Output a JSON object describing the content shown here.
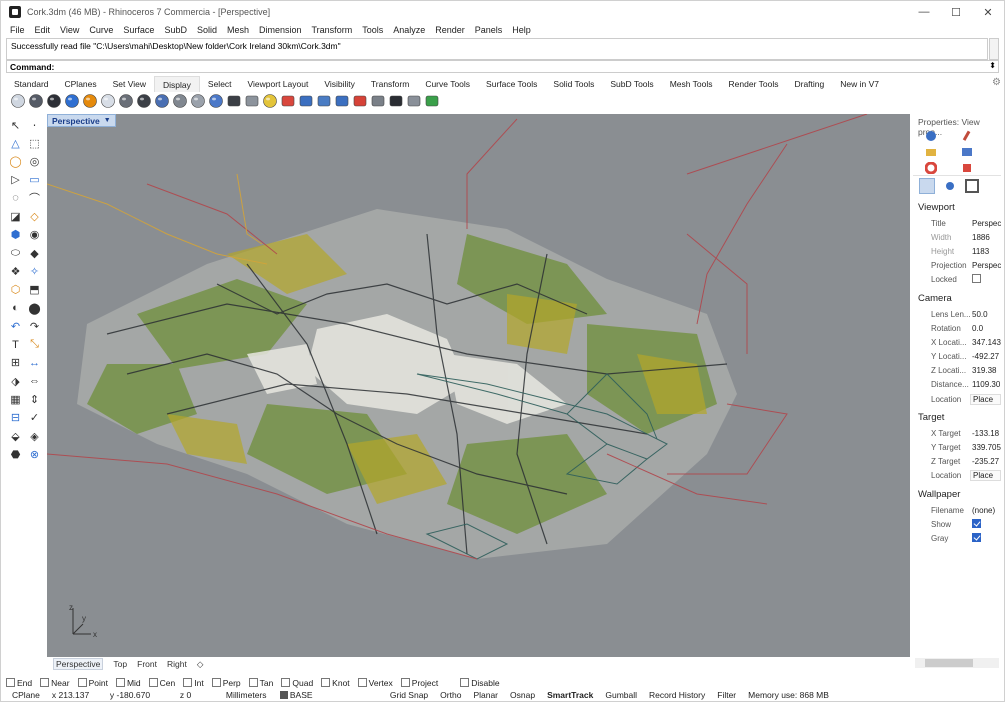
{
  "window": {
    "title": "Cork.3dm (46 MB) - Rhinoceros 7 Commercia - [Perspective]",
    "minimize": "—",
    "maximize": "☐",
    "close": "✕"
  },
  "menu": [
    "File",
    "Edit",
    "View",
    "Curve",
    "Surface",
    "SubD",
    "Solid",
    "Mesh",
    "Dimension",
    "Transform",
    "Tools",
    "Analyze",
    "Render",
    "Panels",
    "Help"
  ],
  "command": {
    "history": "Successfully read file \"C:\\Users\\mahi\\Desktop\\New folder\\Cork Ireland 30km\\Cork.3dm\"",
    "prompt": "Command:"
  },
  "toolbar_tabs": [
    "Standard",
    "CPlanes",
    "Set View",
    "Display",
    "Select",
    "Viewport Layout",
    "Visibility",
    "Transform",
    "Curve Tools",
    "Surface Tools",
    "Solid Tools",
    "SubD Tools",
    "Mesh Tools",
    "Render Tools",
    "Drafting",
    "New in V7"
  ],
  "toolbar_active_tab": "Display",
  "display_icons": [
    {
      "name": "wireframe-icon",
      "color": "#cfd6e0"
    },
    {
      "name": "shaded-icon",
      "color": "#555b66"
    },
    {
      "name": "rendered-icon",
      "color": "#2c2f36"
    },
    {
      "name": "ghosted-icon",
      "color": "#2f6fd1"
    },
    {
      "name": "xray-icon",
      "color": "#e58a0c"
    },
    {
      "name": "technical-icon",
      "color": "#d7dde6"
    },
    {
      "name": "artistic-icon",
      "color": "#6a6f78"
    },
    {
      "name": "pen-icon",
      "color": "#3b3f46"
    },
    {
      "name": "arctic-icon",
      "color": "#4a6fb3"
    },
    {
      "name": "raytraced-icon",
      "color": "#808790"
    },
    {
      "name": "monochrome-icon",
      "color": "#9aa1ab"
    },
    {
      "name": "display-mode-icon",
      "color": "#4b78c8"
    },
    {
      "name": "shade-icon",
      "color": "#3b3f46"
    },
    {
      "name": "material-icon",
      "color": "#8c939c"
    },
    {
      "name": "light-icon",
      "color": "#e3c43a"
    },
    {
      "name": "clipping-icon",
      "color": "#d9473d"
    },
    {
      "name": "section-icon",
      "color": "#3b6fc0"
    },
    {
      "name": "zebra-icon",
      "color": "#4a7cc4"
    },
    {
      "name": "curvature-icon",
      "color": "#3b6fc0"
    },
    {
      "name": "draft-icon",
      "color": "#d64238"
    },
    {
      "name": "environment-icon",
      "color": "#7a8088"
    },
    {
      "name": "monitor-icon",
      "color": "#2a2d33"
    },
    {
      "name": "cage-icon",
      "color": "#8a9099"
    },
    {
      "name": "layers-icon",
      "color": "#3aa04a"
    }
  ],
  "viewport": {
    "label": "Perspective",
    "background": "#8a8e92",
    "axes": {
      "x": "x",
      "y": "y",
      "z": "z"
    }
  },
  "viewport_tabs": [
    "Perspective",
    "Top",
    "Front",
    "Right",
    "◇"
  ],
  "osnaps": [
    {
      "label": "End",
      "checked": false
    },
    {
      "label": "Near",
      "checked": false
    },
    {
      "label": "Point",
      "checked": false
    },
    {
      "label": "Mid",
      "checked": false
    },
    {
      "label": "Cen",
      "checked": false
    },
    {
      "label": "Int",
      "checked": false
    },
    {
      "label": "Perp",
      "checked": false
    },
    {
      "label": "Tan",
      "checked": false
    },
    {
      "label": "Quad",
      "checked": false
    },
    {
      "label": "Knot",
      "checked": false
    },
    {
      "label": "Vertex",
      "checked": false
    },
    {
      "label": "Project",
      "checked": false
    },
    {
      "label": "Disable",
      "checked": false
    }
  ],
  "status": {
    "cplane": "CPlane",
    "x": "x 213.137",
    "y": "y -180.670",
    "z": "z 0",
    "units": "Millimeters",
    "layer": "BASE",
    "grid_snap": "Grid Snap",
    "ortho": "Ortho",
    "planar": "Planar",
    "osnap": "Osnap",
    "smarttrack": "SmartTrack",
    "gumball": "Gumball",
    "record_history": "Record History",
    "filter": "Filter",
    "memory": "Memory use: 868 MB"
  },
  "properties": {
    "title": "Properties: View prop...",
    "sections": {
      "viewport": {
        "heading": "Viewport",
        "rows": [
          {
            "label": "Title",
            "value": "Perspect",
            "disabled": false
          },
          {
            "label": "Width",
            "value": "1886",
            "disabled": true
          },
          {
            "label": "Height",
            "value": "1183",
            "disabled": true
          },
          {
            "label": "Projection",
            "value": "Perspect",
            "disabled": false
          },
          {
            "label": "Locked",
            "value": "",
            "disabled": false
          }
        ]
      },
      "camera": {
        "heading": "Camera",
        "rows": [
          {
            "label": "Lens Len...",
            "value": "50.0"
          },
          {
            "label": "Rotation",
            "value": "0.0"
          },
          {
            "label": "X Locati...",
            "value": "347.143"
          },
          {
            "label": "Y Locati...",
            "value": "-492.27"
          },
          {
            "label": "Z Locati...",
            "value": "319.38"
          },
          {
            "label": "Distance...",
            "value": "1109.30"
          },
          {
            "label": "Location",
            "value": "Place"
          }
        ]
      },
      "target": {
        "heading": "Target",
        "rows": [
          {
            "label": "X Target",
            "value": "-133.18"
          },
          {
            "label": "Y Target",
            "value": "339.705"
          },
          {
            "label": "Z Target",
            "value": "-235.27"
          },
          {
            "label": "Location",
            "value": "Place"
          }
        ]
      },
      "wallpaper": {
        "heading": "Wallpaper",
        "rows": [
          {
            "label": "Filename",
            "value": "(none)"
          },
          {
            "label": "Show",
            "value": "checked"
          },
          {
            "label": "Gray",
            "value": "checked"
          }
        ]
      }
    }
  }
}
